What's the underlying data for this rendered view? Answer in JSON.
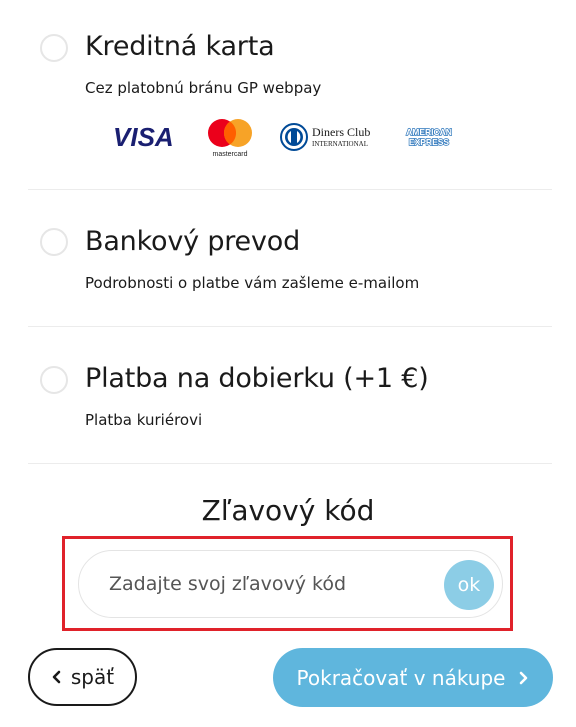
{
  "payment_options": [
    {
      "title": "Kreditná karta",
      "subtitle": "Cez platobnú bránu GP webpay"
    },
    {
      "title": "Bankový prevod",
      "subtitle": "Podrobnosti o platbe vám zašleme e-mailom"
    },
    {
      "title": "Platba na dobierku (+1 €)",
      "subtitle": "Platba kuriérovi"
    }
  ],
  "card_logos": {
    "visa": "VISA",
    "mastercard": "mastercard",
    "diners_line1": "Diners Club",
    "diners_line2": "INTERNATIONAL",
    "amex_line1": "AMERICAN",
    "amex_line2": "EXPRESS"
  },
  "discount": {
    "title": "Zľavový kód",
    "placeholder": "Zadajte svoj zľavový kód",
    "ok_label": "ok"
  },
  "nav": {
    "back_label": "späť",
    "next_label": "Pokračovať v nákupe"
  },
  "colors": {
    "accent": "#5fb6dd",
    "ok_button": "#8ccde6",
    "highlight_border": "#e0222a",
    "visa_blue": "#1a1f71",
    "mc_red": "#eb001b",
    "mc_orange": "#f79e1b",
    "diners_blue": "#004a97",
    "amex_blue": "#2e77bc"
  }
}
